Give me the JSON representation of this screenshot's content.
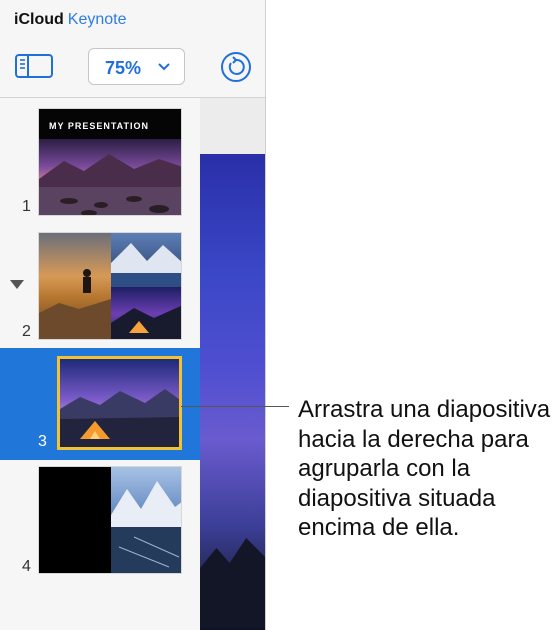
{
  "app": {
    "brand_primary": "iCloud",
    "brand_secondary": "Keynote",
    "zoom_value": "75%",
    "accent_color": "#2f7ce4",
    "selection_color": "#2176d9"
  },
  "toolbar": {
    "sidebar_icon": "sidebar-toggle-icon",
    "zoom_chevron_icon": "chevron-down-icon",
    "undo_icon": "undo-history-icon"
  },
  "slides": [
    {
      "number": "1",
      "title_text": "MY PRESENTATION"
    },
    {
      "number": "2",
      "collapsed_group": true
    },
    {
      "number": "3",
      "selected": true
    },
    {
      "number": "4"
    }
  ],
  "callout": {
    "text": "Arrastra una diapositiva hacia la derecha para agruparla con la diapositiva situada encima de ella."
  }
}
